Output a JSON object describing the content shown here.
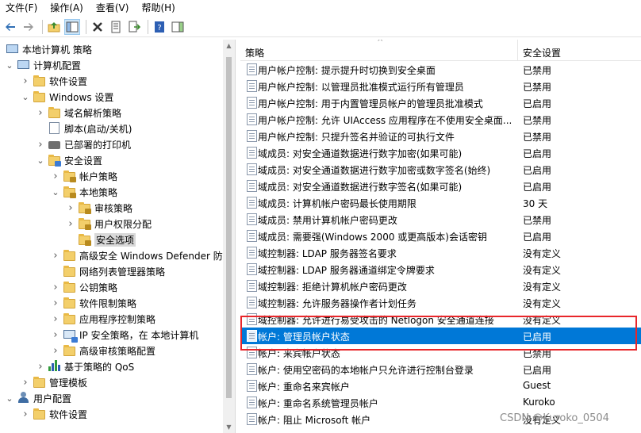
{
  "menu": [
    "文件(F)",
    "操作(A)",
    "查看(V)",
    "帮助(H)"
  ],
  "toolbar": {
    "icons": [
      "back-arrow-icon",
      "forward-arrow-icon",
      "up-folder-icon",
      "show-hide-tree-icon",
      "delete-icon",
      "properties-icon",
      "export-list-icon",
      "help-icon",
      "show-action-pane-icon"
    ]
  },
  "tree": [
    {
      "label": "本地计算机 策略",
      "level": 0,
      "icon": "computer-icon",
      "toggle": ""
    },
    {
      "label": "计算机配置",
      "level": 1,
      "icon": "computer-icon",
      "toggle": "open"
    },
    {
      "label": "软件设置",
      "level": 2,
      "icon": "folder-icon",
      "toggle": "closed"
    },
    {
      "label": "Windows 设置",
      "level": 2,
      "icon": "folder-icon",
      "toggle": "open"
    },
    {
      "label": "域名解析策略",
      "level": 3,
      "icon": "folder-icon",
      "toggle": "closed"
    },
    {
      "label": "脚本(启动/关机)",
      "level": 3,
      "icon": "script-icon",
      "toggle": ""
    },
    {
      "label": "已部署的打印机",
      "level": 3,
      "icon": "printer-icon",
      "toggle": "closed"
    },
    {
      "label": "安全设置",
      "level": 3,
      "icon": "shield-icon",
      "toggle": "open"
    },
    {
      "label": "帐户策略",
      "level": 4,
      "icon": "folder-lock-icon",
      "toggle": "closed"
    },
    {
      "label": "本地策略",
      "level": 4,
      "icon": "folder-lock-icon",
      "toggle": "open"
    },
    {
      "label": "审核策略",
      "level": 5,
      "icon": "folder-lock-icon",
      "toggle": "closed"
    },
    {
      "label": "用户权限分配",
      "level": 5,
      "icon": "folder-lock-icon",
      "toggle": "closed"
    },
    {
      "label": "安全选项",
      "level": 5,
      "icon": "folder-lock-icon",
      "toggle": "",
      "selected": true
    },
    {
      "label": "高级安全 Windows Defender 防",
      "level": 4,
      "icon": "folder-icon",
      "toggle": "closed"
    },
    {
      "label": "网络列表管理器策略",
      "level": 4,
      "icon": "folder-icon",
      "toggle": ""
    },
    {
      "label": "公钥策略",
      "level": 4,
      "icon": "folder-icon",
      "toggle": "closed"
    },
    {
      "label": "软件限制策略",
      "level": 4,
      "icon": "folder-icon",
      "toggle": "closed"
    },
    {
      "label": "应用程序控制策略",
      "level": 4,
      "icon": "folder-icon",
      "toggle": "closed"
    },
    {
      "label": "IP 安全策略，在 本地计算机",
      "level": 4,
      "icon": "ip-security-icon",
      "toggle": "closed"
    },
    {
      "label": "高级审核策略配置",
      "level": 4,
      "icon": "folder-icon",
      "toggle": "closed"
    },
    {
      "label": "基于策略的 QoS",
      "level": 3,
      "icon": "bar-chart-icon",
      "toggle": "closed"
    },
    {
      "label": "管理模板",
      "level": 2,
      "icon": "folder-icon",
      "toggle": "closed"
    },
    {
      "label": "用户配置",
      "level": 1,
      "icon": "users-icon",
      "toggle": "open"
    },
    {
      "label": "软件设置",
      "level": 2,
      "icon": "folder-icon",
      "toggle": "closed"
    }
  ],
  "list": {
    "col_policy": "策略",
    "col_setting": "安全设置",
    "rows": [
      {
        "name": "用户帐户控制: 提示提升时切换到安全桌面",
        "value": "已禁用"
      },
      {
        "name": "用户帐户控制: 以管理员批准模式运行所有管理员",
        "value": "已禁用"
      },
      {
        "name": "用户帐户控制: 用于内置管理员帐户的管理员批准模式",
        "value": "已启用"
      },
      {
        "name": "用户帐户控制: 允许 UIAccess 应用程序在不使用安全桌面...",
        "value": "已禁用"
      },
      {
        "name": "用户帐户控制: 只提升签名并验证的可执行文件",
        "value": "已禁用"
      },
      {
        "name": "域成员: 对安全通道数据进行数字加密(如果可能)",
        "value": "已启用"
      },
      {
        "name": "域成员: 对安全通道数据进行数字加密或数字签名(始终)",
        "value": "已启用"
      },
      {
        "name": "域成员: 对安全通道数据进行数字签名(如果可能)",
        "value": "已启用"
      },
      {
        "name": "域成员: 计算机帐户密码最长使用期限",
        "value": "30 天"
      },
      {
        "name": "域成员: 禁用计算机帐户密码更改",
        "value": "已禁用"
      },
      {
        "name": "域成员: 需要强(Windows 2000 或更高版本)会话密钥",
        "value": "已启用"
      },
      {
        "name": "域控制器: LDAP 服务器签名要求",
        "value": "没有定义"
      },
      {
        "name": "域控制器: LDAP 服务器通道绑定令牌要求",
        "value": "没有定义"
      },
      {
        "name": "域控制器: 拒绝计算机帐户密码更改",
        "value": "没有定义"
      },
      {
        "name": "域控制器: 允许服务器操作者计划任务",
        "value": "没有定义"
      },
      {
        "name": "域控制器: 允许进行易受攻击的 Netlogon 安全通道连接",
        "value": "没有定义"
      },
      {
        "name": "帐户: 管理员帐户状态",
        "value": "已启用",
        "selected": true
      },
      {
        "name": "帐户: 来宾帐户状态",
        "value": "已禁用"
      },
      {
        "name": "帐户: 使用空密码的本地帐户只允许进行控制台登录",
        "value": "已启用"
      },
      {
        "name": "帐户: 重命名来宾帐户",
        "value": "Guest"
      },
      {
        "name": "帐户: 重命名系统管理员帐户",
        "value": "Kuroko"
      },
      {
        "name": "帐户: 阻止 Microsoft 帐户",
        "value": "没有定义"
      }
    ]
  },
  "watermark": "CSDN @Kuroko_0504",
  "colors": {
    "selection": "#0078d7",
    "highlight_box": "#e8262a"
  }
}
